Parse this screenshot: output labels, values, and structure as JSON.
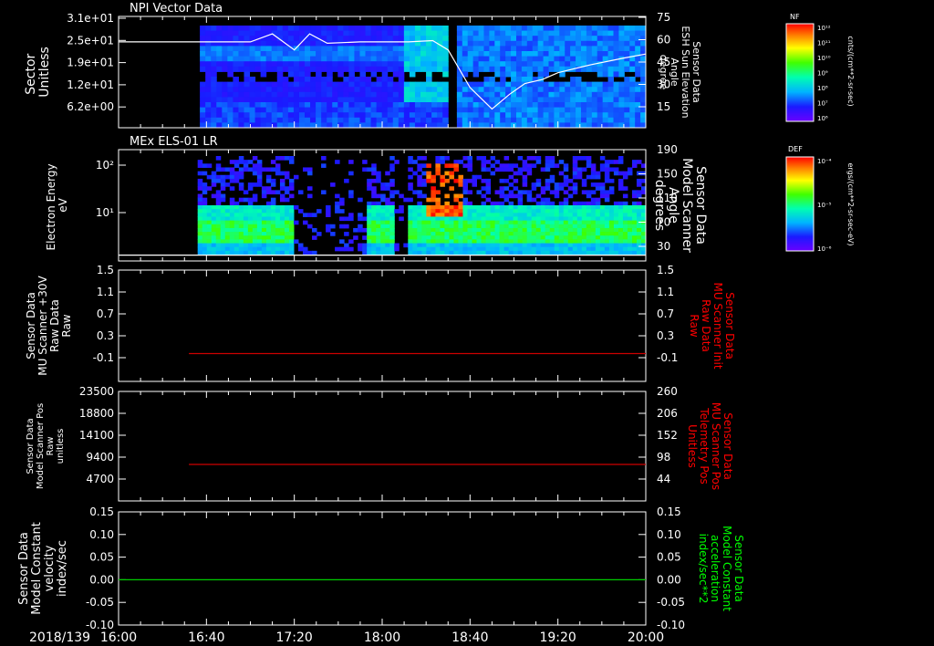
{
  "panel_titles": [
    "NPI Vector Data",
    "MEx ELS-01 LR"
  ],
  "date_label": "2018/139",
  "time_ticks": [
    "16:00",
    "16:40",
    "17:20",
    "18:00",
    "18:40",
    "19:20",
    "20:00"
  ],
  "colorbars": [
    {
      "label": "NF",
      "unit": "cnts/(cm**2-sr-sec)",
      "ticks": [
        "10¹²",
        "10¹¹",
        "10¹⁰",
        "10⁹",
        "10⁸",
        "10⁷",
        "10⁶"
      ]
    },
    {
      "label": "DEF",
      "unit": "ergs/(cm**2-sr-sec-eV)",
      "ticks": [
        "10⁻⁴",
        "10⁻⁵",
        "10⁻⁶"
      ]
    }
  ],
  "chart_data": [
    {
      "type": "heatmap",
      "title": "NPI Vector Data",
      "ylabel_lines": [
        "Sector",
        "Unitless"
      ],
      "yticks": [
        "3.1e+01",
        "2.5e+01",
        "1.9e+01",
        "1.2e+01",
        "6.2e+00"
      ],
      "right_label_lines": [
        "Sensor Data",
        "ESH Sun Elevation",
        "Angle",
        "degree"
      ],
      "right_ticks": [
        "75",
        "60",
        "45",
        "30",
        "15"
      ],
      "right_ylim": [
        0,
        75
      ],
      "xlim": [
        "16:00",
        "20:00"
      ],
      "data_coverage_minutes": [
        [
          37,
          150
        ],
        [
          154,
          240
        ]
      ],
      "series": [
        {
          "name": "ESH Sun Elevation Angle",
          "color": "#ffffff",
          "x_minutes": [
            0,
            30,
            60,
            70,
            80,
            87,
            95,
            110,
            122,
            132,
            143,
            150,
            160,
            170,
            178,
            185,
            193,
            200,
            215,
            230,
            240
          ],
          "y": [
            56,
            56,
            56,
            62,
            50,
            62,
            55,
            56,
            56,
            56,
            57,
            50,
            22,
            6,
            17,
            25,
            28,
            33,
            39,
            44,
            47
          ]
        }
      ]
    },
    {
      "type": "heatmap",
      "title": "MEx ELS-01 LR",
      "ylabel_lines": [
        "Electron Energy",
        "eV"
      ],
      "yticks": [
        "10²",
        "10¹"
      ],
      "right_label_lines": [
        "Sensor Data",
        "Model Scanner",
        "Angle",
        "degrees"
      ],
      "right_ticks": [
        "190",
        "150",
        "110",
        "70",
        "30"
      ],
      "right_ylim": [
        0,
        190
      ],
      "xlim": [
        "16:00",
        "20:00"
      ],
      "data_coverage_minutes": [
        [
          36,
          240
        ]
      ],
      "series": [
        {
          "name": "Model Scanner Angle",
          "color": "#ffffff",
          "x_minutes": [
            0,
            240
          ],
          "y": [
            10,
            10
          ]
        }
      ]
    },
    {
      "type": "line",
      "ylabel_lines": [
        "Sensor Data",
        "MU Scanner +30V",
        "Raw Data",
        "Raw"
      ],
      "yticks": [
        "1.5",
        "1.1",
        "0.7",
        "0.3",
        "-0.1"
      ],
      "ylim": [
        -0.5,
        1.5
      ],
      "right_label_lines": [
        "Sensor Data",
        "MU Scanner Init",
        "Raw Data",
        "Raw"
      ],
      "right_ticks": [
        "1.5",
        "1.1",
        "0.7",
        "0.3",
        "-0.1"
      ],
      "xlim": [
        "16:00",
        "20:00"
      ],
      "series": [
        {
          "name": "MU Scanner Init Raw Data",
          "color": "#cc0000",
          "x_minutes": [
            32,
            240
          ],
          "y": [
            0.0,
            0.0
          ]
        }
      ]
    },
    {
      "type": "line",
      "ylabel_lines": [
        "Sensor Data",
        "Model Scanner Pos",
        "Raw",
        "unitless"
      ],
      "yticks": [
        "23500",
        "18800",
        "14100",
        "9400",
        "4700"
      ],
      "ylim": [
        0,
        23500
      ],
      "right_label_lines": [
        "Sensor Data",
        "MU Scanner Pos",
        "Telemetry Pos",
        "Unitless"
      ],
      "right_ticks": [
        "260",
        "206",
        "152",
        "98",
        "44"
      ],
      "right_ylim": [
        0,
        260
      ],
      "xlim": [
        "16:00",
        "20:00"
      ],
      "series": [
        {
          "name": "MU Scanner Pos Telemetry Pos",
          "color": "#cc0000",
          "x_minutes": [
            32,
            240
          ],
          "y": [
            8400,
            8400
          ]
        }
      ]
    },
    {
      "type": "line",
      "ylabel_lines": [
        "Sensor Data",
        "Model Constant",
        "velocity",
        "index/sec"
      ],
      "yticks": [
        "0.15",
        "0.10",
        "0.05",
        "0.00",
        "-0.05",
        "-0.10"
      ],
      "ylim": [
        -0.1,
        0.15
      ],
      "right_label_lines": [
        "Sensor Data",
        "Model Constant",
        "acceleration",
        "index/sec**2"
      ],
      "right_ticks": [
        "0.15",
        "0.10",
        "0.05",
        "0.00",
        "-0.05",
        "-0.10"
      ],
      "xlim": [
        "16:00",
        "20:00"
      ],
      "series": [
        {
          "name": "Model Constant acceleration",
          "color": "#00cc00",
          "x_minutes": [
            0,
            240
          ],
          "y": [
            0.0,
            0.0
          ]
        }
      ]
    }
  ],
  "right_label_colors": [
    "#ffffff",
    "#ffffff",
    "#ff0000",
    "#ff0000",
    "#00ff00"
  ]
}
